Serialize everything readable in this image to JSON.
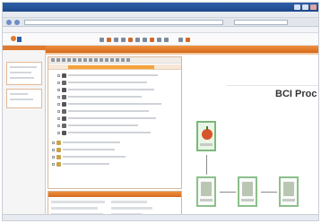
{
  "window": {
    "title": ""
  },
  "diagram": {
    "title": "BCI Proc"
  },
  "colors": {
    "accent": "#e07a2e",
    "window_chrome": "#2f5fa8",
    "node_border": "#8cc08a"
  },
  "icons": {
    "logo": "app-logo",
    "tree_item": "document-icon",
    "node": "process-step-icon"
  }
}
